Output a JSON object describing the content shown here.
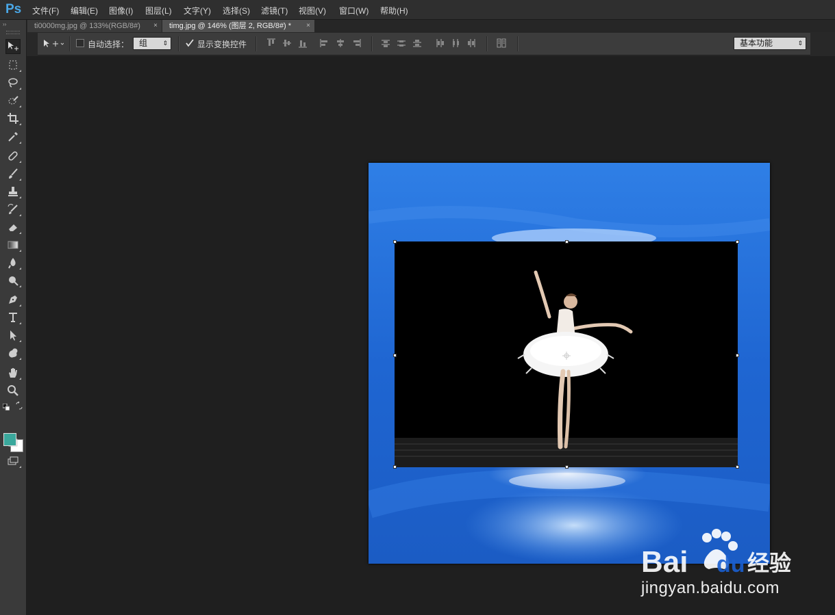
{
  "app": {
    "logo": "Ps"
  },
  "menu": [
    "文件(F)",
    "编辑(E)",
    "图像(I)",
    "图层(L)",
    "文字(Y)",
    "选择(S)",
    "滤镜(T)",
    "视图(V)",
    "窗口(W)",
    "帮助(H)"
  ],
  "tabs": [
    {
      "label": "ti0000mg.jpg @ 133%(RGB/8#)",
      "close": "×",
      "active": false
    },
    {
      "label": "timg.jpg @ 146% (图层 2, RGB/8#) *",
      "close": "×",
      "active": true
    }
  ],
  "options": {
    "auto_select_label": "自动选择：",
    "auto_select_checked": false,
    "auto_select_value": "组",
    "show_transform_label": "显示变换控件",
    "show_transform_checked": true,
    "workspace_value": "基本功能"
  },
  "colors": {
    "foreground": "#3aa89c",
    "background": "#ffffff",
    "accent": "#4aa8e8"
  },
  "tools": [
    "move-tool",
    "marquee-tool",
    "lasso-tool",
    "quick-selection-tool",
    "crop-tool",
    "eyedropper-tool",
    "healing-brush-tool",
    "brush-tool",
    "clone-stamp-tool",
    "history-brush-tool",
    "eraser-tool",
    "gradient-tool",
    "blur-tool",
    "dodge-tool",
    "pen-tool",
    "type-tool",
    "path-selection-tool",
    "shape-tool",
    "hand-tool",
    "zoom-tool"
  ],
  "watermark": {
    "brand": "Bai du 经验",
    "url": "jingyan.baidu.com"
  }
}
